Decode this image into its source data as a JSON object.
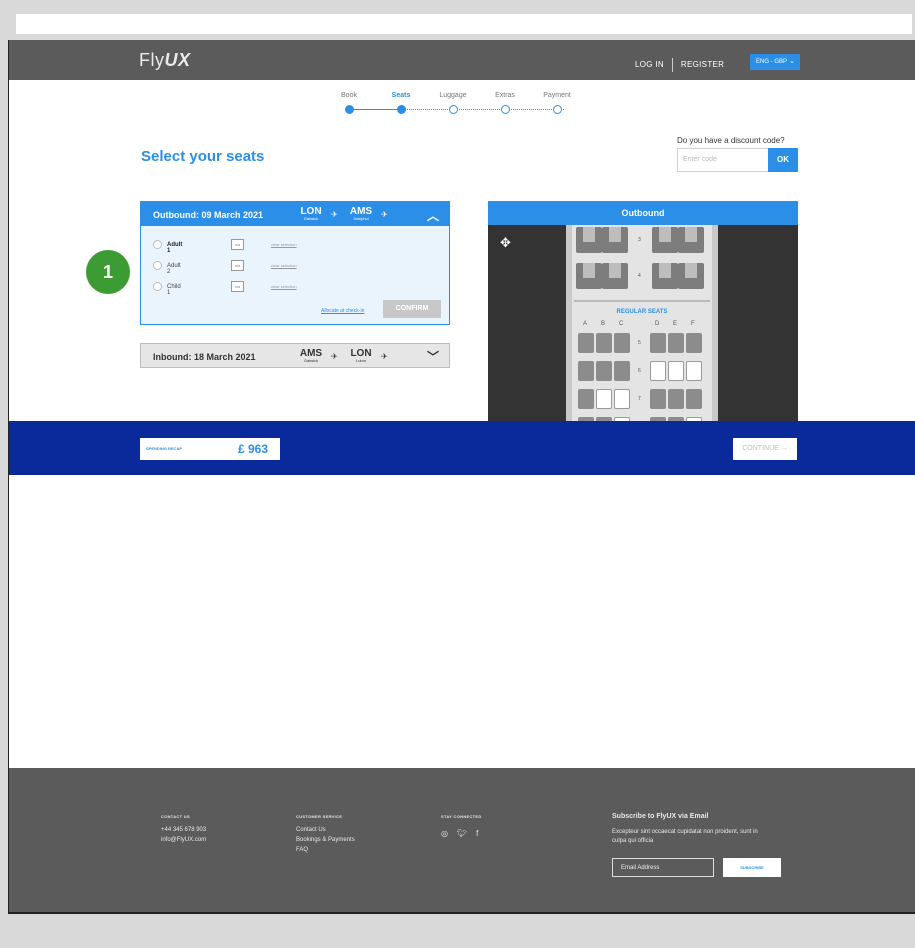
{
  "header": {
    "logo_light": "Fly",
    "logo_bold": "UX",
    "login": "LOG IN",
    "register": "REGISTER",
    "language": "ENG - GBP"
  },
  "steps": [
    {
      "label": "Book",
      "state": "done"
    },
    {
      "label": "Seats",
      "state": "active"
    },
    {
      "label": "Luggage",
      "state": "todo"
    },
    {
      "label": "Extras",
      "state": "todo"
    },
    {
      "label": "Payment",
      "state": "todo"
    }
  ],
  "page_title": "Select your seats",
  "discount": {
    "question": "Do you have a discount code?",
    "placeholder": "Enter code",
    "ok": "OK"
  },
  "outbound": {
    "title": "Outbound: 09 March 2021",
    "from_code": "LON",
    "from_airport": "Gatwick",
    "to_code": "AMS",
    "to_airport": "Schiphol",
    "passengers": [
      {
        "name": "Adult 1",
        "seat": "n/a",
        "clear": "clear selection"
      },
      {
        "name": "Adult 2",
        "seat": "n/a",
        "clear": "clear selection"
      },
      {
        "name": "Child 1",
        "seat": "n/a",
        "clear": "clear selection"
      }
    ],
    "allocate": "Allocate at check-in",
    "confirm": "CONFIRM"
  },
  "inbound": {
    "title": "Inbound: 18 March 2021",
    "from_code": "AMS",
    "from_airport": "Gatwick",
    "to_code": "LON",
    "to_airport": "Luton"
  },
  "badge": "1",
  "seatmap": {
    "title": "Outbound",
    "section_label": "REGULAR SEATS",
    "columns": [
      "A",
      "B",
      "C",
      "D",
      "E",
      "F"
    ],
    "rows": [
      "3",
      "4",
      "5",
      "6",
      "7"
    ]
  },
  "recap": {
    "label": "SPENDING RECAP",
    "amount": "£ 963",
    "continue": "CONTINUE →"
  },
  "footer": {
    "contact_head": "CONTACT US",
    "phone": "+44 345 678 903",
    "email": "info@FlyUX.com",
    "service_head": "CUSTOMER SERVICE",
    "service_links": [
      "Contact Us",
      "Bookings & Payments",
      "FAQ"
    ],
    "social_head": "STAY CONNECTED",
    "subscribe_title": "Subscribe to FlyUX via Email",
    "subscribe_text": "Excepteur sint occaecat cupidatat non proident, sunt in culpa qui officia",
    "email_placeholder": "Email Address",
    "subscribe_button": "SUBSCRIBE"
  }
}
